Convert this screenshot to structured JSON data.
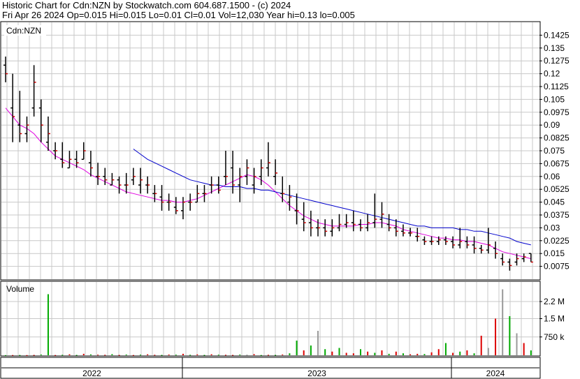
{
  "header": {
    "line1": "Historic Chart for Cdn:NZN by Stockwatch.com 604.687.1500 - (c) 2024",
    "line2": "Fri Apr 26 2024   Op=0.015   Hi=0.015   Lo=0.01   Cl=0.01   Vol=12,030   Year hi=0.13   lo=0.005"
  },
  "colors": {
    "grid": "#c8c8c8",
    "bar": "#000000",
    "close_tick": "#cc0000",
    "ma_short": "#e000e0",
    "ma_long": "#0000cc",
    "vol_up": "#00aa00",
    "vol_down": "#dd0000",
    "vol_flat": "#999999"
  },
  "chart_data": [
    {
      "type": "ohlc",
      "panel_label": "Cdn:NZN",
      "ylim": [
        0.0,
        0.15
      ],
      "yticks": [
        "0.1425",
        "0.135",
        "0.1275",
        "0.12",
        "0.1125",
        "0.105",
        "0.0975",
        "0.09",
        "0.0825",
        "0.075",
        "0.0675",
        "0.06",
        "0.0525",
        "0.045",
        "0.0375",
        "0.03",
        "0.0225",
        "0.015",
        "0.0075"
      ],
      "x_labels": [
        "2022",
        "2023",
        "2024"
      ],
      "x_range": [
        "2021-10",
        "2024-04"
      ],
      "bars": [
        [
          0.125,
          0.13,
          0.115,
          0.12
        ],
        [
          0.1,
          0.12,
          0.08,
          0.095
        ],
        [
          0.09,
          0.11,
          0.08,
          0.085
        ],
        [
          0.085,
          0.095,
          0.08,
          0.09
        ],
        [
          0.1,
          0.125,
          0.095,
          0.115
        ],
        [
          0.1,
          0.105,
          0.08,
          0.09
        ],
        [
          0.08,
          0.095,
          0.075,
          0.085
        ],
        [
          0.075,
          0.08,
          0.07,
          0.075
        ],
        [
          0.07,
          0.08,
          0.065,
          0.068
        ],
        [
          0.065,
          0.075,
          0.065,
          0.07
        ],
        [
          0.07,
          0.075,
          0.065,
          0.068
        ],
        [
          0.07,
          0.08,
          0.07,
          0.075
        ],
        [
          0.068,
          0.075,
          0.06,
          0.065
        ],
        [
          0.06,
          0.068,
          0.055,
          0.06
        ],
        [
          0.06,
          0.065,
          0.055,
          0.058
        ],
        [
          0.055,
          0.062,
          0.055,
          0.058
        ],
        [
          0.058,
          0.06,
          0.05,
          0.055
        ],
        [
          0.055,
          0.062,
          0.05,
          0.055
        ],
        [
          0.058,
          0.065,
          0.055,
          0.06
        ],
        [
          0.055,
          0.065,
          0.05,
          0.058
        ],
        [
          0.055,
          0.06,
          0.05,
          0.055
        ],
        [
          0.05,
          0.055,
          0.045,
          0.05
        ],
        [
          0.048,
          0.055,
          0.04,
          0.045
        ],
        [
          0.045,
          0.05,
          0.04,
          0.045
        ],
        [
          0.042,
          0.048,
          0.038,
          0.04
        ],
        [
          0.04,
          0.048,
          0.035,
          0.045
        ],
        [
          0.045,
          0.05,
          0.04,
          0.045
        ],
        [
          0.045,
          0.055,
          0.045,
          0.05
        ],
        [
          0.05,
          0.055,
          0.045,
          0.05
        ],
        [
          0.055,
          0.06,
          0.05,
          0.055
        ],
        [
          0.055,
          0.06,
          0.05,
          0.052
        ],
        [
          0.06,
          0.075,
          0.055,
          0.06
        ],
        [
          0.065,
          0.075,
          0.05,
          0.055
        ],
        [
          0.055,
          0.065,
          0.045,
          0.06
        ],
        [
          0.06,
          0.07,
          0.055,
          0.065
        ],
        [
          0.055,
          0.065,
          0.05,
          0.06
        ],
        [
          0.06,
          0.07,
          0.055,
          0.065
        ],
        [
          0.065,
          0.08,
          0.06,
          0.068
        ],
        [
          0.06,
          0.07,
          0.055,
          0.062
        ],
        [
          0.05,
          0.06,
          0.045,
          0.05
        ],
        [
          0.045,
          0.055,
          0.04,
          0.048
        ],
        [
          0.04,
          0.05,
          0.032,
          0.04
        ],
        [
          0.035,
          0.045,
          0.028,
          0.033
        ],
        [
          0.033,
          0.04,
          0.025,
          0.03
        ],
        [
          0.03,
          0.035,
          0.025,
          0.03
        ],
        [
          0.03,
          0.035,
          0.025,
          0.028
        ],
        [
          0.028,
          0.035,
          0.025,
          0.03
        ],
        [
          0.03,
          0.038,
          0.028,
          0.032
        ],
        [
          0.032,
          0.038,
          0.03,
          0.033
        ],
        [
          0.033,
          0.04,
          0.028,
          0.032
        ],
        [
          0.032,
          0.035,
          0.028,
          0.03
        ],
        [
          0.03,
          0.038,
          0.028,
          0.033
        ],
        [
          0.033,
          0.05,
          0.03,
          0.035
        ],
        [
          0.035,
          0.045,
          0.03,
          0.038
        ],
        [
          0.032,
          0.038,
          0.028,
          0.03
        ],
        [
          0.03,
          0.035,
          0.025,
          0.028
        ],
        [
          0.028,
          0.032,
          0.025,
          0.027
        ],
        [
          0.027,
          0.03,
          0.025,
          0.027
        ],
        [
          0.025,
          0.03,
          0.022,
          0.025
        ],
        [
          0.023,
          0.025,
          0.02,
          0.022
        ],
        [
          0.022,
          0.025,
          0.02,
          0.022
        ],
        [
          0.022,
          0.025,
          0.02,
          0.023
        ],
        [
          0.023,
          0.025,
          0.02,
          0.022
        ],
        [
          0.022,
          0.025,
          0.018,
          0.02
        ],
        [
          0.02,
          0.03,
          0.018,
          0.022
        ],
        [
          0.022,
          0.025,
          0.018,
          0.02
        ],
        [
          0.02,
          0.025,
          0.015,
          0.018
        ],
        [
          0.018,
          0.02,
          0.015,
          0.017
        ],
        [
          0.017,
          0.03,
          0.015,
          0.02
        ],
        [
          0.018,
          0.022,
          0.012,
          0.015
        ],
        [
          0.012,
          0.015,
          0.008,
          0.01
        ],
        [
          0.01,
          0.012,
          0.005,
          0.008
        ],
        [
          0.01,
          0.015,
          0.008,
          0.012
        ],
        [
          0.012,
          0.015,
          0.01,
          0.013
        ],
        [
          0.015,
          0.015,
          0.01,
          0.01
        ]
      ],
      "series": [
        {
          "name": "",
          "values": [
            0.1,
            0.095,
            0.09,
            0.088,
            0.085,
            0.08,
            0.076,
            0.072,
            0.07,
            0.068,
            0.066,
            0.064,
            0.061,
            0.059,
            0.057,
            0.055,
            0.053,
            0.051,
            0.05,
            0.049,
            0.048,
            0.047,
            0.046,
            0.046,
            0.045,
            0.045,
            0.046,
            0.047,
            0.049,
            0.051,
            0.053,
            0.055,
            0.057,
            0.059,
            0.061,
            0.06,
            0.058,
            0.055,
            0.051,
            0.047,
            0.043,
            0.04,
            0.037,
            0.035,
            0.033,
            0.032,
            0.031,
            0.031,
            0.031,
            0.031,
            0.032,
            0.032,
            0.033,
            0.033,
            0.032,
            0.031,
            0.029,
            0.028,
            0.027,
            0.026,
            0.025,
            0.024,
            0.024,
            0.023,
            0.023,
            0.022,
            0.022,
            0.021,
            0.02,
            0.018,
            0.016,
            0.015,
            0.014,
            0.013,
            0.012
          ]
        },
        {
          "name": "",
          "values": [
            null,
            null,
            null,
            null,
            null,
            null,
            null,
            null,
            null,
            null,
            null,
            null,
            null,
            null,
            null,
            null,
            null,
            null,
            0.076,
            0.073,
            0.07,
            0.068,
            0.066,
            0.064,
            0.062,
            0.06,
            0.058,
            0.057,
            0.056,
            0.055,
            0.055,
            0.054,
            0.054,
            0.054,
            0.053,
            0.053,
            0.052,
            0.052,
            0.051,
            0.05,
            0.049,
            0.048,
            0.047,
            0.046,
            0.045,
            0.044,
            0.043,
            0.042,
            0.041,
            0.04,
            0.039,
            0.038,
            0.037,
            0.036,
            0.035,
            0.034,
            0.033,
            0.032,
            0.031,
            0.031,
            0.03,
            0.03,
            0.03,
            0.03,
            0.029,
            0.029,
            0.028,
            0.028,
            0.027,
            0.026,
            0.025,
            0.024,
            0.022,
            0.021,
            0.02
          ]
        }
      ]
    },
    {
      "type": "bar",
      "panel_label": "Volume",
      "ylim": [
        0,
        3000000
      ],
      "yticks": [
        "2.2 M",
        "1.5 M",
        "750 k"
      ],
      "values": [
        5000,
        10000,
        12000,
        8000,
        15000,
        30000,
        2500000,
        10000,
        20000,
        40000,
        15000,
        60000,
        35000,
        25000,
        20000,
        45000,
        15000,
        30000,
        10000,
        25000,
        40000,
        20000,
        15000,
        30000,
        25000,
        60000,
        20000,
        35000,
        15000,
        40000,
        25000,
        20000,
        15000,
        30000,
        25000,
        45000,
        10000,
        20000,
        15000,
        30000,
        80000,
        600000,
        200000,
        400000,
        1000000,
        250000,
        150000,
        300000,
        100000,
        80000,
        250000,
        150000,
        100000,
        200000,
        60000,
        150000,
        80000,
        40000,
        60000,
        50000,
        120000,
        250000,
        500000,
        100000,
        150000,
        200000,
        80000,
        800000,
        300000,
        1500000,
        2700000,
        1600000,
        900000,
        500000,
        200000
      ],
      "dirs": [
        "g",
        "r",
        "g",
        "r",
        "r",
        "g",
        "g",
        "r",
        "g",
        "r",
        "g",
        "r",
        "g",
        "r",
        "r",
        "g",
        "r",
        "g",
        "r",
        "g",
        "r",
        "r",
        "g",
        "r",
        "g",
        "r",
        "g",
        "r",
        "g",
        "r",
        "g",
        "r",
        "r",
        "g",
        "n",
        "r",
        "g",
        "r",
        "g",
        "r",
        "g",
        "g",
        "r",
        "g",
        "n",
        "g",
        "r",
        "g",
        "r",
        "r",
        "g",
        "r",
        "g",
        "r",
        "g",
        "r",
        "g",
        "r",
        "r",
        "g",
        "r",
        "r",
        "g",
        "r",
        "g",
        "r",
        "g",
        "r",
        "n",
        "r",
        "n",
        "g",
        "n",
        "r",
        "g"
      ]
    }
  ]
}
